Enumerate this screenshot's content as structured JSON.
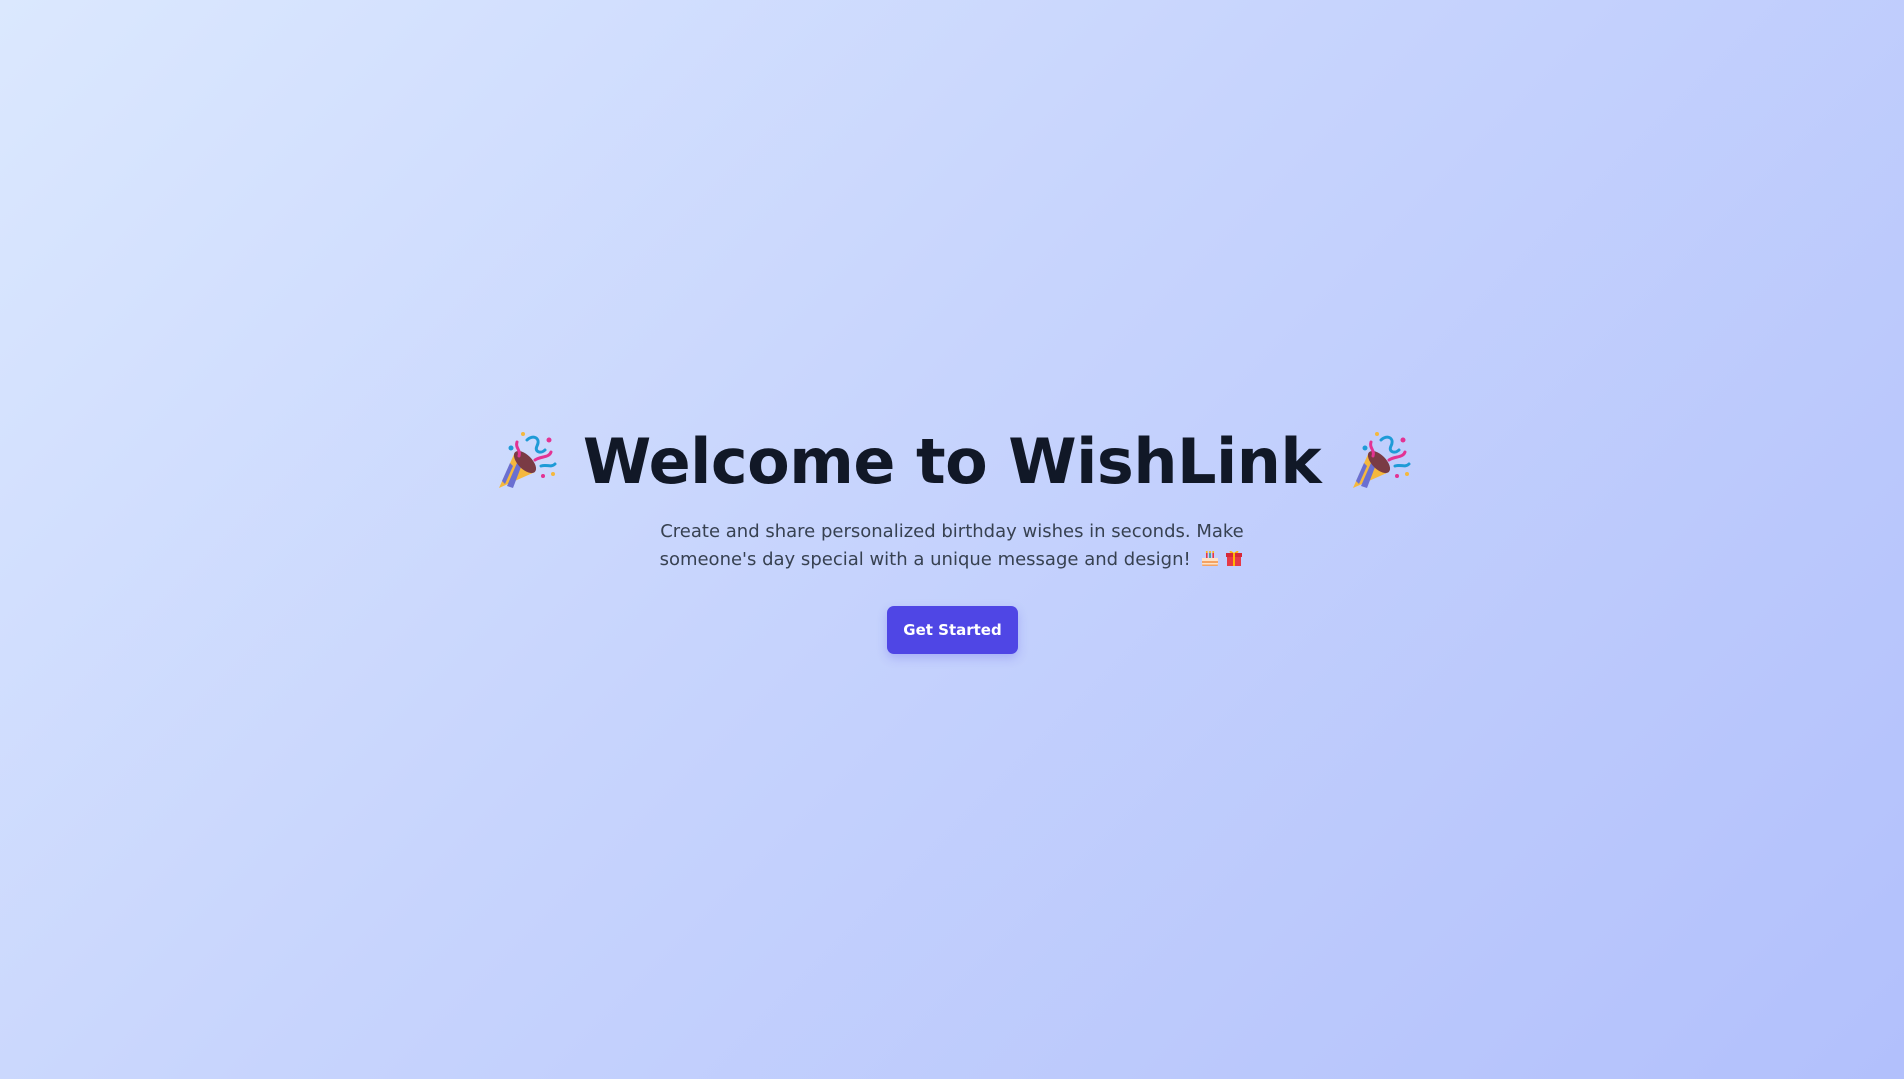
{
  "hero": {
    "title": "Welcome to WishLink",
    "subtitle": "Create and share personalized birthday wishes in seconds. Make someone's day special with a unique message and design!",
    "cta_label": "Get Started",
    "icons": {
      "title_left": "party-popper-icon",
      "title_right": "party-popper-icon",
      "subtitle_first": "birthday-cake-icon",
      "subtitle_second": "gift-icon"
    }
  },
  "colors": {
    "background_start": "#dbe8fe",
    "background_end": "#b2c0fc",
    "title": "#111827",
    "text": "#374151",
    "button": "#4f46e5",
    "button_text": "#ffffff"
  }
}
